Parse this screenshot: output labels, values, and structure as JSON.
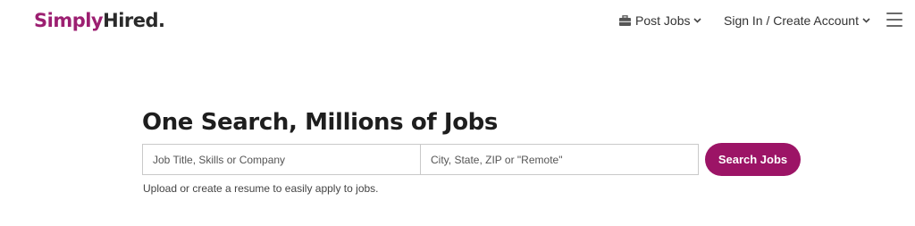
{
  "header": {
    "logo_part1": "Simply",
    "logo_part2": "Hired.",
    "post_jobs_label": "Post Jobs",
    "signin_label": "Sign In / Create Account"
  },
  "hero": {
    "headline": "One Search, Millions of Jobs"
  },
  "search": {
    "what_placeholder": "Job Title, Skills or Company",
    "what_value": "",
    "where_placeholder": "City, State, ZIP or \"Remote\"",
    "where_value": "",
    "button_label": "Search Jobs"
  },
  "helper": {
    "upload_link": "Upload",
    "or_text": " or ",
    "create_link": "create a resume",
    "suffix": " to easily apply to jobs."
  },
  "colors": {
    "brand": "#9c1466",
    "logo_dark": "#2a2a2a",
    "text": "#222222"
  },
  "icons": {
    "post_jobs": "briefcase-icon",
    "dropdown": "chevron-down-icon",
    "menu": "hamburger-menu-icon"
  }
}
